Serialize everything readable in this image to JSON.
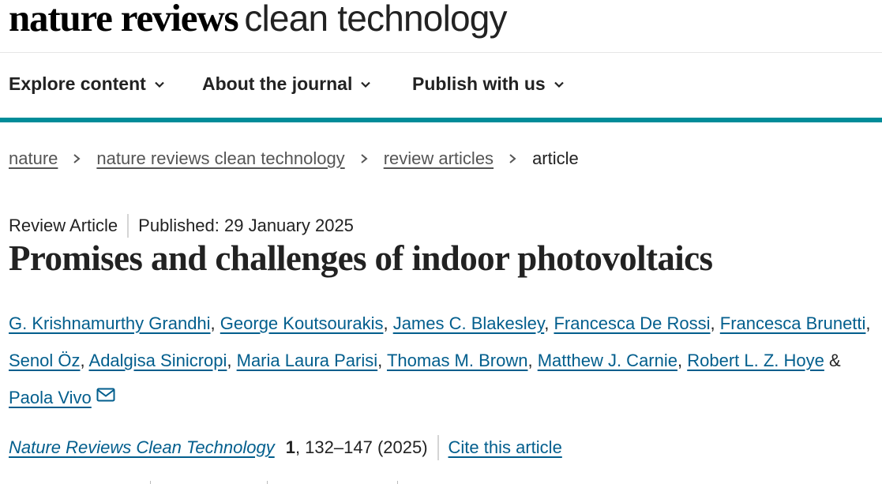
{
  "site": {
    "logo_bold": "nature reviews",
    "logo_light": "clean technology"
  },
  "nav": {
    "items": [
      {
        "label": "Explore content"
      },
      {
        "label": "About the journal"
      },
      {
        "label": "Publish with us"
      }
    ]
  },
  "breadcrumb": {
    "items": [
      "nature",
      "nature reviews clean technology",
      "review articles"
    ],
    "current": "article"
  },
  "article": {
    "type": "Review Article",
    "published": "Published: 29 January 2025",
    "title": "Promises and challenges of indoor photovoltaics",
    "authors": [
      "G. Krishnamurthy Grandhi",
      "George Koutsourakis",
      "James C. Blakesley",
      "Francesca De Rossi",
      "Francesca Brunetti",
      "Senol Öz",
      "Adalgisa Sinicropi",
      "Maria Laura Parisi",
      "Thomas M. Brown",
      "Matthew J. Carnie",
      "Robert L. Z. Hoye",
      "Paola Vivo"
    ],
    "authors_separator": ", ",
    "authors_last_separator": " & ",
    "corresponding_icon": "mail-icon",
    "journal": "Nature Reviews Clean Technology",
    "volume": "1",
    "pages_year": ", 132–147 (2025)",
    "cite_label": "Cite this article"
  },
  "colors": {
    "accent_teal": "#008c99",
    "link_blue": "#025e8d"
  }
}
